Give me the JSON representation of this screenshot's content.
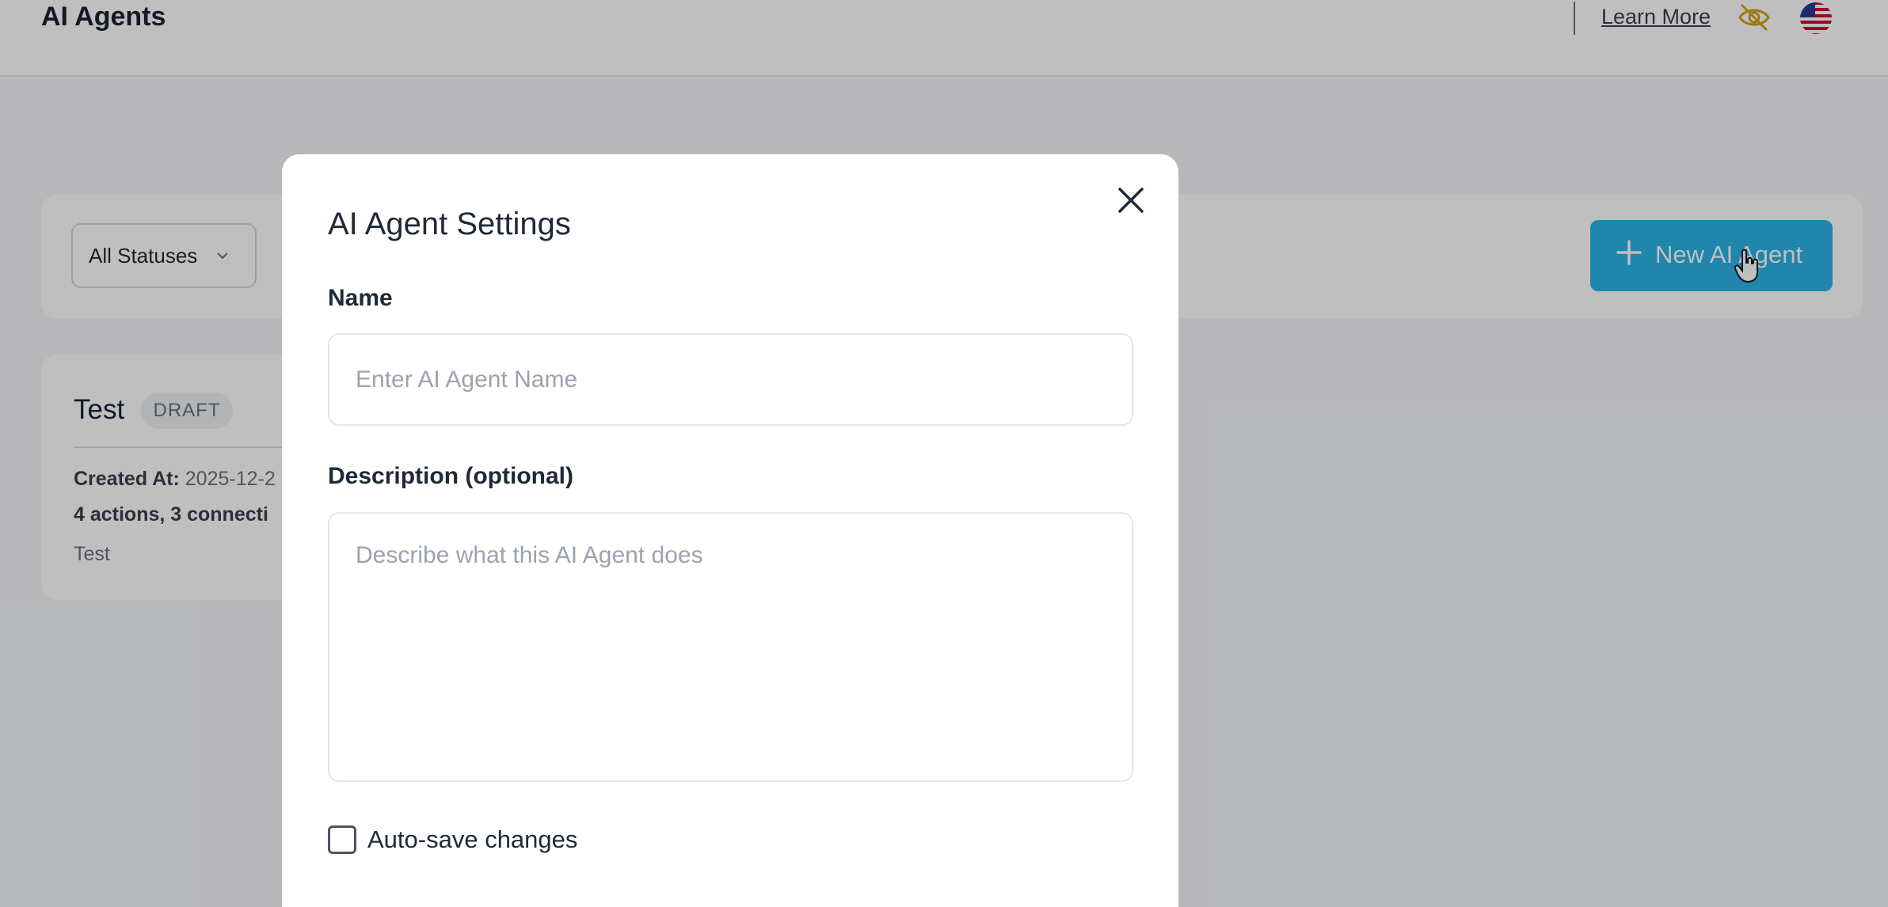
{
  "header": {
    "page_title": "AI Agents",
    "learn_more": "Learn More",
    "icons": [
      "eye-off-icon",
      "us-flag-icon"
    ]
  },
  "filters": {
    "status_select": "All Statuses"
  },
  "toolbar": {
    "new_agent_label": "New AI Agent",
    "accent_color": "#2bb3e6"
  },
  "agent_card": {
    "name": "Test",
    "badge": "DRAFT",
    "created_label": "Created At:",
    "created_value": "2025-12-2",
    "stats": "4 actions, 3 connecti",
    "description": "Test"
  },
  "modal": {
    "title": "AI Agent Settings",
    "name_label": "Name",
    "name_placeholder": "Enter AI Agent Name",
    "name_value": "",
    "description_label": "Description (optional)",
    "description_placeholder": "Describe what this AI Agent does",
    "description_value": "",
    "autosave_label": "Auto-save changes",
    "autosave_checked": false
  }
}
